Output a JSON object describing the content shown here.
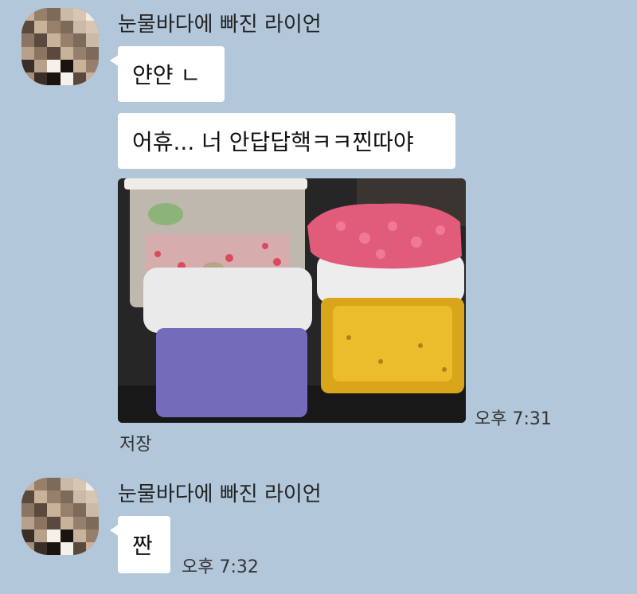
{
  "messages": [
    {
      "sender": "눈물바다에 빠진 라이언",
      "texts": [
        "얀얀 ㄴ",
        "어휴... 너 안답답핵ㅋㅋ찐따야"
      ],
      "image": {
        "description_icon": "photo-slime-jars",
        "save_label": "저장"
      },
      "time": "오후 7:31"
    },
    {
      "sender": "눈물바다에 빠진 라이언",
      "texts": [
        "짠"
      ],
      "time": "오후 7:32"
    }
  ],
  "colors": {
    "background": "#b2c7da",
    "bubble": "#ffffff"
  }
}
